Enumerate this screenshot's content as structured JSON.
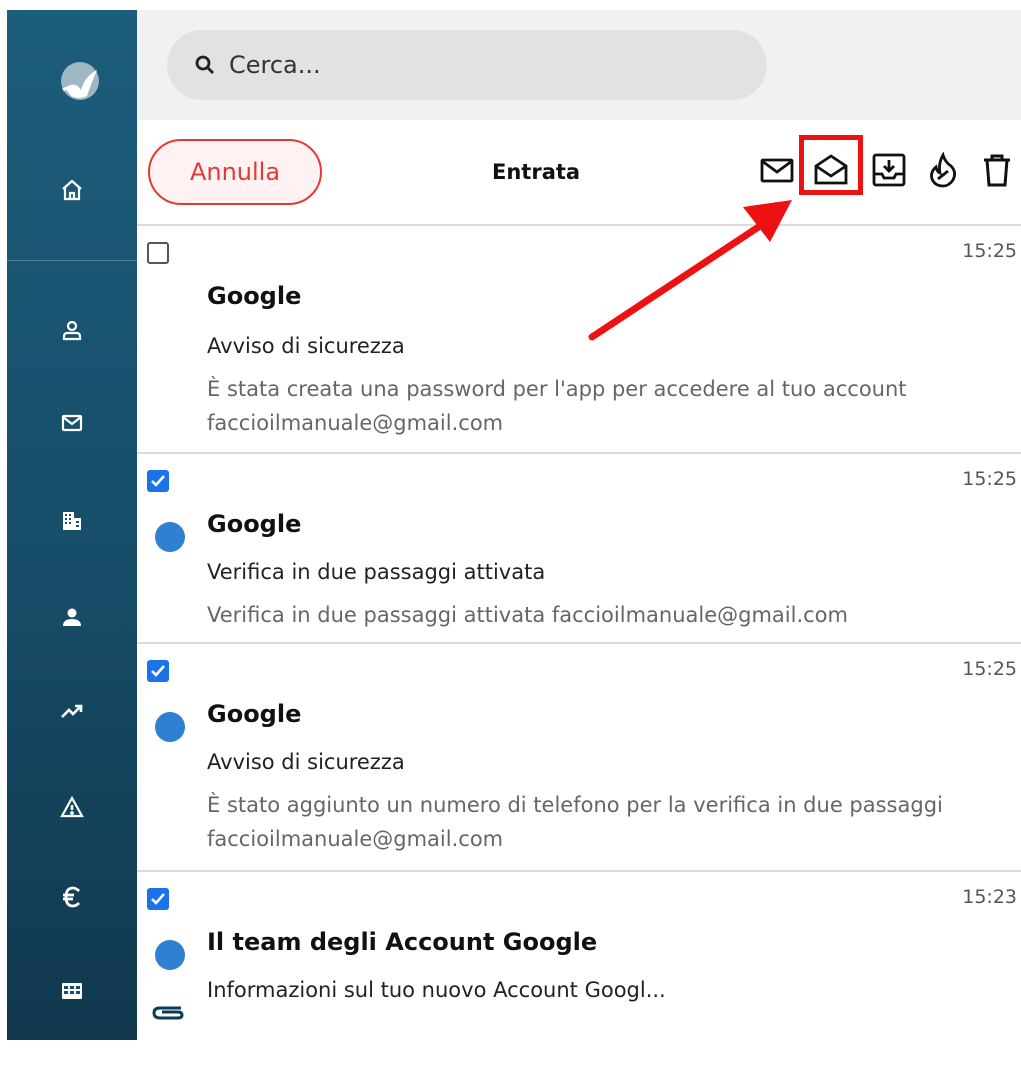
{
  "search": {
    "placeholder": "Cerca..."
  },
  "toolbar": {
    "cancel_label": "Annulla",
    "folder_title": "Entrata",
    "icons": [
      "mark-unread-icon",
      "mark-read-icon",
      "archive-icon",
      "spam-icon",
      "delete-icon"
    ]
  },
  "sidebar": {
    "icons": [
      "home-icon",
      "contacts-icon",
      "mail-icon",
      "buildings-icon",
      "user-icon",
      "trending-icon",
      "warning-icon",
      "euro-icon",
      "grid-icon"
    ]
  },
  "messages": [
    {
      "checked": false,
      "unread": false,
      "time": "15:25",
      "sender": "Google",
      "subject": "Avviso di sicurezza",
      "preview": "È stata creata una password per l'app per accedere al tuo account faccioilmanuale@gmail.com"
    },
    {
      "checked": true,
      "unread": true,
      "time": "15:25",
      "sender": "Google",
      "subject": "Verifica in due passaggi attivata",
      "preview": "Verifica in due passaggi attivata faccioilmanuale@gmail.com"
    },
    {
      "checked": true,
      "unread": true,
      "time": "15:25",
      "sender": "Google",
      "subject": "Avviso di sicurezza",
      "preview": "È stato aggiunto un numero di telefono per la verifica in due passaggi faccioilmanuale@gmail.com"
    },
    {
      "checked": true,
      "unread": true,
      "attachment": true,
      "time": "15:23",
      "sender": "Il team degli Account Google",
      "subject": "Informazioni sul tuo nuovo Account Googl..."
    }
  ],
  "colors": {
    "sidebar": "#174e6a",
    "accent_red": "#e53935",
    "unread_dot": "#2f80d0",
    "checkbox": "#1a73e8",
    "annotation": "#ee1111"
  }
}
